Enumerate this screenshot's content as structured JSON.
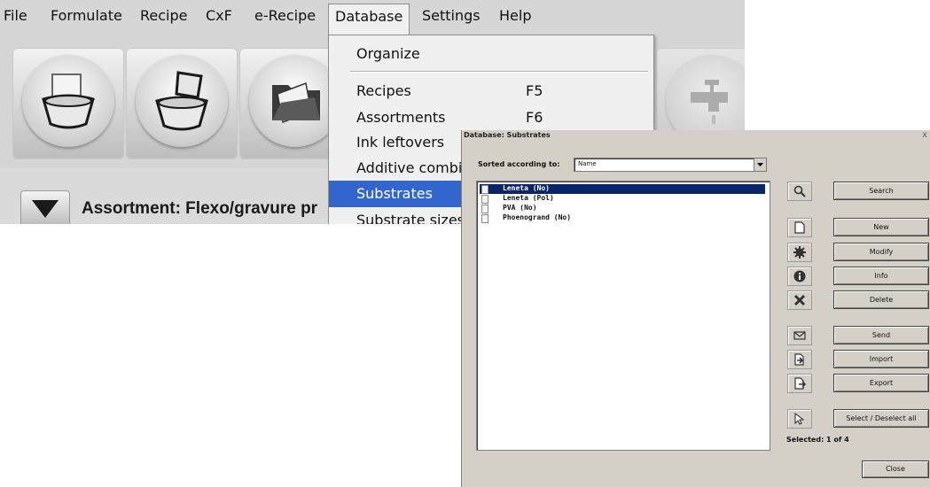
{
  "menubar": {
    "items": [
      "File",
      "Formulate",
      "Recipe",
      "CxF",
      "e-Recipe",
      "Database",
      "Settings",
      "Help"
    ]
  },
  "toolbar": {
    "buttons": [
      "new-recipe-icon",
      "pour-ink-icon",
      "open-folder-icon",
      "faucet-icon"
    ]
  },
  "assortment": {
    "label": "Assortment: Flexo/gravure pr"
  },
  "database_menu": {
    "items": [
      {
        "label": "Organize",
        "shortcut": ""
      },
      {
        "label": "Recipes",
        "shortcut": "F5"
      },
      {
        "label": "Assortments",
        "shortcut": "F6"
      },
      {
        "label": "Ink leftovers",
        "shortcut": ""
      },
      {
        "label": "Additive combi",
        "shortcut": ""
      },
      {
        "label": "Substrates",
        "shortcut": ""
      },
      {
        "label": "Substrate sizes",
        "shortcut": ""
      }
    ],
    "highlighted": "Substrates"
  },
  "dialog": {
    "title": "Database: Substrates",
    "close_glyph": "x",
    "sort_label": "Sorted according to:",
    "sort_value": "Name",
    "list": [
      "Leneta (No)",
      "Leneta (Pol)",
      "PVA (No)",
      "Phoenogrand (No)"
    ],
    "selected_index": 0,
    "buttons": {
      "search": "Search",
      "new": "New",
      "modify": "Modify",
      "info": "Info",
      "delete": "Delete",
      "send": "Send",
      "import": "Import",
      "export": "Export",
      "select_all": "Select / Deselect all",
      "close": "Close"
    },
    "selected_status": "Selected:  1 of 4"
  },
  "colors": {
    "menu_highlight": "#3366cc",
    "list_selection": "#0a246a",
    "dialog_face": "#d4d0c8",
    "app_background": "#d7d7d7"
  }
}
